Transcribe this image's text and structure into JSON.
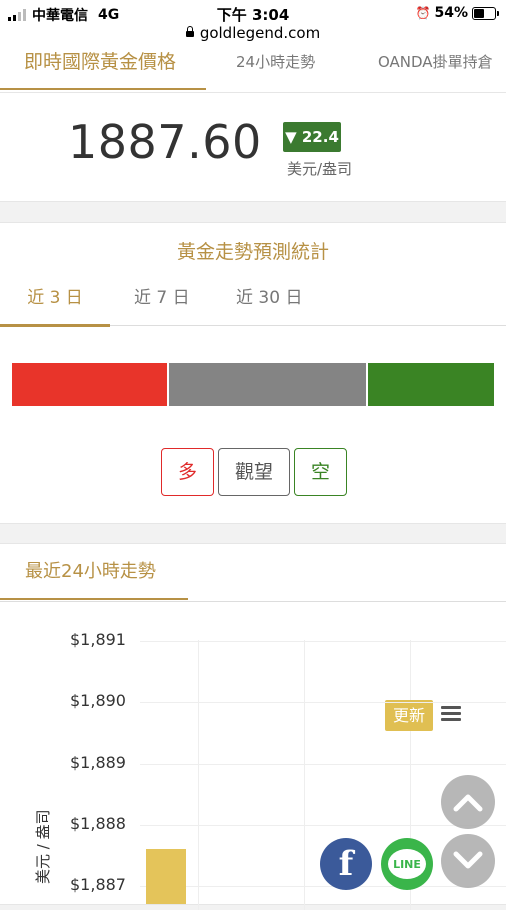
{
  "status_bar": {
    "carrier": "中華電信",
    "network": "4G",
    "time": "下午 3:04",
    "url": "goldlegend.com",
    "battery": "54%",
    "battery_level": 0.54
  },
  "top_tabs": [
    "即時國際黃金價格",
    "24小時走勢",
    "OANDA掛單持倉"
  ],
  "price": {
    "value": "1887.60",
    "change": "▼ 22.4",
    "unit": "美元/盎司"
  },
  "forecast": {
    "title": "黃金走勢預測統計",
    "tabs": [
      "近 3 日",
      "近 7 日",
      "近 30 日"
    ],
    "options": {
      "long": "多",
      "neutral": "觀望",
      "short": "空"
    },
    "colors": {
      "long": "#e8342a",
      "neutral": "#848484",
      "short": "#3a8424"
    }
  },
  "trend": {
    "title": "最近24小時走勢",
    "refresh_label": "更新"
  },
  "chart_data": {
    "type": "bar",
    "ylabel": "美元 / 盎司",
    "yticks": [
      "$1,891",
      "$1,890",
      "$1,889",
      "$1,888",
      "$1,887"
    ],
    "ylim": [
      1887,
      1891
    ],
    "values": [
      1887.6
    ],
    "grid": true
  },
  "floating_buttons": {
    "facebook": "f",
    "line": "LINE"
  }
}
